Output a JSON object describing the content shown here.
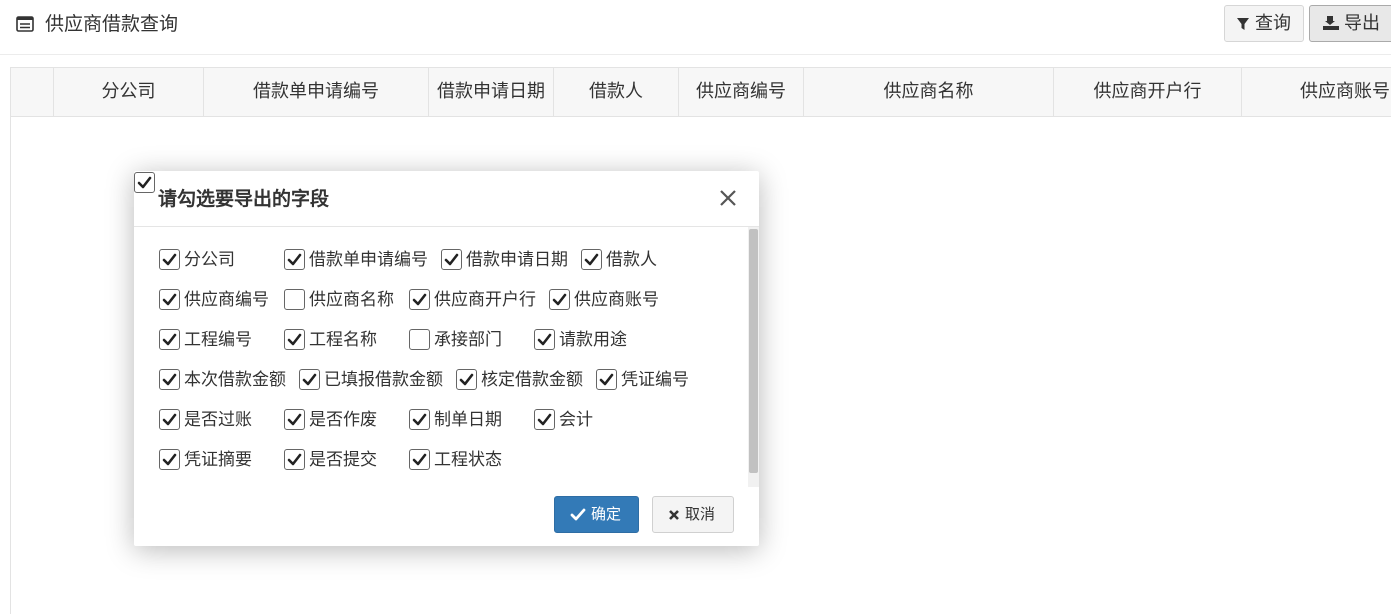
{
  "header": {
    "title": "供应商借款查询",
    "title_icon": "list-window-icon"
  },
  "toolbar": {
    "query_label": "查询",
    "export_label": "导出"
  },
  "table": {
    "columns": [
      "分公司",
      "借款单申请编号",
      "借款申请日期",
      "借款人",
      "供应商编号",
      "供应商名称",
      "供应商开户行",
      "供应商账号"
    ]
  },
  "modal": {
    "title": "请勾选要导出的字段",
    "select_all_checked": true,
    "fields": [
      {
        "label": "分公司",
        "checked": true
      },
      {
        "label": "借款单申请编号",
        "checked": true
      },
      {
        "label": "借款申请日期",
        "checked": true
      },
      {
        "label": "借款人",
        "checked": true
      },
      {
        "label": "供应商编号",
        "checked": true
      },
      {
        "label": "供应商名称",
        "checked": false
      },
      {
        "label": "供应商开户行",
        "checked": true
      },
      {
        "label": "供应商账号",
        "checked": true
      },
      {
        "label": "工程编号",
        "checked": true
      },
      {
        "label": "工程名称",
        "checked": true
      },
      {
        "label": "承接部门",
        "checked": false
      },
      {
        "label": "请款用途",
        "checked": true
      },
      {
        "label": "本次借款金额",
        "checked": true
      },
      {
        "label": "已填报借款金额",
        "checked": true
      },
      {
        "label": "核定借款金额",
        "checked": true
      },
      {
        "label": "凭证编号",
        "checked": true
      },
      {
        "label": "是否过账",
        "checked": true
      },
      {
        "label": "是否作废",
        "checked": true
      },
      {
        "label": "制单日期",
        "checked": true
      },
      {
        "label": "会计",
        "checked": true
      },
      {
        "label": "凭证摘要",
        "checked": true
      },
      {
        "label": "是否提交",
        "checked": true
      },
      {
        "label": "工程状态",
        "checked": true
      }
    ],
    "ok_label": "确定",
    "cancel_label": "取消"
  },
  "colors": {
    "primary": "#337ab7",
    "header_bg": "#f7f7f7",
    "border": "#e3e3e3"
  }
}
